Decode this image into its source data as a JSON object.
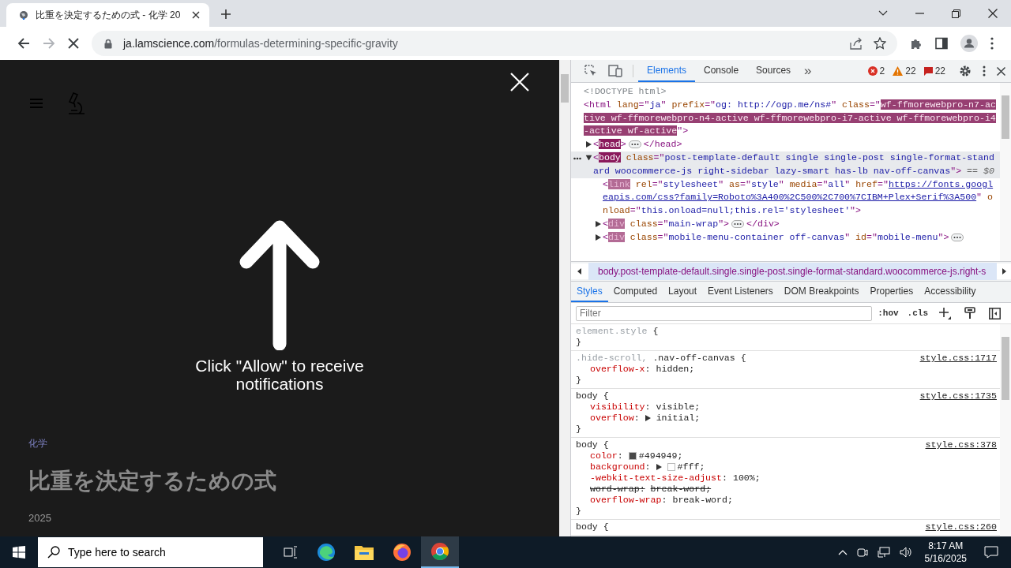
{
  "browser": {
    "tab": {
      "title": "比重を決定するための式 - 化学 20"
    },
    "address": {
      "domain": "ja.lamscience.com",
      "path": "/formulas-determining-specific-gravity"
    }
  },
  "page": {
    "prompt": "Click \"Allow\" to receive notifications",
    "category": "化学",
    "title": "比重を決定するための式",
    "date": "2025"
  },
  "devtools": {
    "tabs": [
      {
        "label": "Elements",
        "selected": true
      },
      {
        "label": "Console",
        "selected": false
      },
      {
        "label": "Sources",
        "selected": false
      }
    ],
    "more_tabs": "»",
    "counts": [
      {
        "kind": "error",
        "count": "2"
      },
      {
        "kind": "warning",
        "count": "22"
      },
      {
        "kind": "issue",
        "count": "22"
      }
    ],
    "dom": [
      {
        "selected": false,
        "segs": [
          {
            "kind": "doctype",
            "text": "<!DOCTYPE html>"
          }
        ]
      },
      {
        "selected": false,
        "segs": [
          {
            "kind": "punct",
            "text": "<"
          },
          {
            "kind": "tag",
            "text": "html"
          },
          {
            "kind": "attr",
            "text": " lang"
          },
          {
            "kind": "punct",
            "text": "=\""
          },
          {
            "kind": "value",
            "text": "ja"
          },
          {
            "kind": "punct",
            "text": "\""
          },
          {
            "kind": "attr",
            "text": " prefix"
          },
          {
            "kind": "punct",
            "text": "=\""
          },
          {
            "kind": "value",
            "text": "og: http://ogp.me/ns#"
          },
          {
            "kind": "punct",
            "text": "\""
          },
          {
            "kind": "attr",
            "text": " class"
          },
          {
            "kind": "punct",
            "text": "=\""
          },
          {
            "kind": "hl",
            "text": "wf-ffmorewebpro-n7-active wf-ffmorewebpro-n4-active wf-ffmorewebpro-i7-active wf-ffmorewebpro-i4-active wf-active"
          },
          {
            "kind": "punct",
            "text": "\">"
          }
        ],
        "children": [
          {
            "selected": false,
            "expanded": false,
            "segs": [
              {
                "kind": "punct",
                "text": "<"
              },
              {
                "kind": "tag-hl",
                "text": "head"
              },
              {
                "kind": "punct",
                "text": ">"
              },
              {
                "kind": "dots"
              },
              {
                "kind": "punct",
                "text": "</head>"
              }
            ]
          },
          {
            "selected": true,
            "expanded": true,
            "segs": [
              {
                "kind": "punct",
                "text": "<"
              },
              {
                "kind": "tag-hl",
                "text": "body"
              },
              {
                "kind": "attr",
                "text": " class"
              },
              {
                "kind": "punct",
                "text": "=\""
              },
              {
                "kind": "value",
                "text": "post-template-default single single-post single-format-standard woocommerce-js right-sidebar lazy-smart has-lb nav-off-canvas"
              },
              {
                "kind": "punct",
                "text": "\">"
              },
              {
                "kind": "ref",
                "text": " == $0"
              }
            ],
            "children": [
              {
                "selected": false,
                "segs": [
                  {
                    "kind": "punct",
                    "text": "<"
                  },
                  {
                    "kind": "tag-dim",
                    "text": "link"
                  },
                  {
                    "kind": "attr",
                    "text": " rel"
                  },
                  {
                    "kind": "punct",
                    "text": "=\""
                  },
                  {
                    "kind": "value",
                    "text": "stylesheet"
                  },
                  {
                    "kind": "punct",
                    "text": "\""
                  },
                  {
                    "kind": "attr",
                    "text": " as"
                  },
                  {
                    "kind": "punct",
                    "text": "=\""
                  },
                  {
                    "kind": "value",
                    "text": "style"
                  },
                  {
                    "kind": "punct",
                    "text": "\""
                  },
                  {
                    "kind": "attr",
                    "text": " media"
                  },
                  {
                    "kind": "punct",
                    "text": "=\""
                  },
                  {
                    "kind": "value",
                    "text": "all"
                  },
                  {
                    "kind": "punct",
                    "text": "\""
                  },
                  {
                    "kind": "attr",
                    "text": " href"
                  },
                  {
                    "kind": "punct",
                    "text": "=\""
                  },
                  {
                    "kind": "link",
                    "text": "https://fonts.googleapis.com/css?family=Roboto%3A400%2C500%2C700%7CIBM+Plex+Serif%3A500"
                  },
                  {
                    "kind": "punct",
                    "text": "\""
                  },
                  {
                    "kind": "attr",
                    "text": " onload"
                  },
                  {
                    "kind": "punct",
                    "text": "=\""
                  },
                  {
                    "kind": "value",
                    "text": "this.onload=null;this.rel='stylesheet'"
                  },
                  {
                    "kind": "punct",
                    "text": "\">"
                  }
                ]
              },
              {
                "selected": false,
                "expanded": false,
                "segs": [
                  {
                    "kind": "punct",
                    "text": "<"
                  },
                  {
                    "kind": "tag-dim",
                    "text": "div"
                  },
                  {
                    "kind": "attr",
                    "text": " class"
                  },
                  {
                    "kind": "punct",
                    "text": "=\""
                  },
                  {
                    "kind": "value",
                    "text": "main-wrap"
                  },
                  {
                    "kind": "punct",
                    "text": "\">"
                  },
                  {
                    "kind": "dots"
                  },
                  {
                    "kind": "punct",
                    "text": "</div>"
                  }
                ]
              },
              {
                "selected": false,
                "expanded": false,
                "segs": [
                  {
                    "kind": "punct",
                    "text": "<"
                  },
                  {
                    "kind": "tag-dim",
                    "text": "div"
                  },
                  {
                    "kind": "attr",
                    "text": " class"
                  },
                  {
                    "kind": "punct",
                    "text": "=\""
                  },
                  {
                    "kind": "value",
                    "text": "mobile-menu-container off-canvas"
                  },
                  {
                    "kind": "punct",
                    "text": "\""
                  },
                  {
                    "kind": "attr",
                    "text": " id"
                  },
                  {
                    "kind": "punct",
                    "text": "=\""
                  },
                  {
                    "kind": "value",
                    "text": "mobile-menu"
                  },
                  {
                    "kind": "punct",
                    "text": "\">"
                  },
                  {
                    "kind": "dots"
                  }
                ]
              }
            ]
          }
        ]
      }
    ],
    "breadcrumb": "body.post-template-default.single.single-post.single-format-standard.woocommerce-js.right-s",
    "style_tabs": [
      {
        "label": "Styles",
        "selected": true
      },
      {
        "label": "Computed",
        "selected": false
      },
      {
        "label": "Layout",
        "selected": false
      },
      {
        "label": "Event Listeners",
        "selected": false
      },
      {
        "label": "DOM Breakpoints",
        "selected": false
      },
      {
        "label": "Properties",
        "selected": false
      },
      {
        "label": "Accessibility",
        "selected": false
      }
    ],
    "filter_placeholder": "Filter",
    "toggles": [
      ":hov",
      ".cls"
    ],
    "rules": [
      {
        "selector": [
          {
            "text": "element.style",
            "matched": false
          },
          {
            "text": " {",
            "matched": true
          }
        ],
        "close": "}"
      },
      {
        "selector": [
          {
            "text": ".hide-scroll,",
            "matched": false
          },
          {
            "text": " .nav-off-canvas {",
            "matched": true
          }
        ],
        "source": "style.css:1717",
        "decls": [
          {
            "prop": "overflow-x",
            "colon": ":",
            "value": "hidden;"
          }
        ],
        "close": "}"
      },
      {
        "selector": [
          {
            "text": "body {",
            "matched": true
          }
        ],
        "source": "style.css:1735",
        "decls": [
          {
            "prop": "visibility",
            "colon": ":",
            "value": "visible;"
          },
          {
            "prop": "overflow",
            "colon": ":",
            "value": "initial;",
            "expandable": true
          }
        ],
        "close": "}"
      },
      {
        "selector": [
          {
            "text": "body {",
            "matched": true
          }
        ],
        "source": "style.css:378",
        "decls": [
          {
            "prop": "color",
            "colon": ":",
            "value": "#494949;",
            "color": "#494949"
          },
          {
            "prop": "background",
            "colon": ":",
            "value": "#fff;",
            "expandable": true,
            "color": "#ffffff"
          },
          {
            "prop": "-webkit-text-size-adjust",
            "colon": ":",
            "value": "100%;"
          },
          {
            "prop": "word-wrap",
            "colon": ":",
            "value": "break-word;",
            "overridden": true
          },
          {
            "prop": "overflow-wrap",
            "colon": ":",
            "value": "break-word;"
          }
        ],
        "close": "}"
      },
      {
        "selector": [
          {
            "text": "body {",
            "matched": true
          }
        ],
        "source": "style.css:260"
      }
    ]
  },
  "taskbar": {
    "search_placeholder": "Type here to search",
    "time": "8:17 AM",
    "date": "5/16/2025"
  }
}
